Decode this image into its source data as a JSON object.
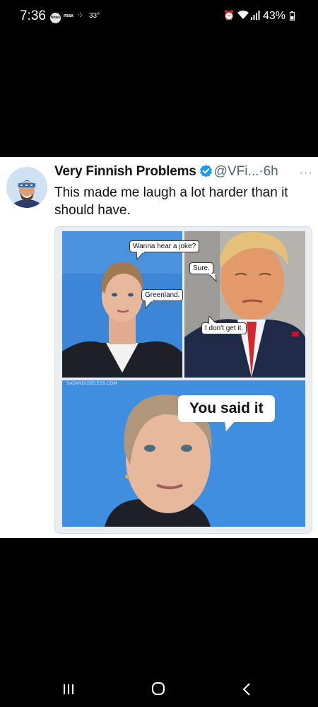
{
  "status_bar": {
    "time": "7:36",
    "news_badge": "News",
    "app_label": "max",
    "weather_icon": "weather-icon",
    "temperature": "33°",
    "battery": "43%"
  },
  "tweet": {
    "author_name": "Very Finnish Problems",
    "handle": "@VFi...",
    "separator": "·",
    "time": "6h",
    "more": "···",
    "text": "This made me laugh a lot harder than it should have.",
    "verified_color": "#1d9bf0"
  },
  "meme": {
    "watermark": "SADANDUSELESS.COM",
    "bubbles": [
      "Wanna hear a joke?",
      "Sure.",
      "Greenland.",
      "I don't get it.",
      "You said it"
    ]
  },
  "nav_bar": {
    "icons": [
      "recent-apps-icon",
      "home-icon",
      "back-icon"
    ]
  }
}
